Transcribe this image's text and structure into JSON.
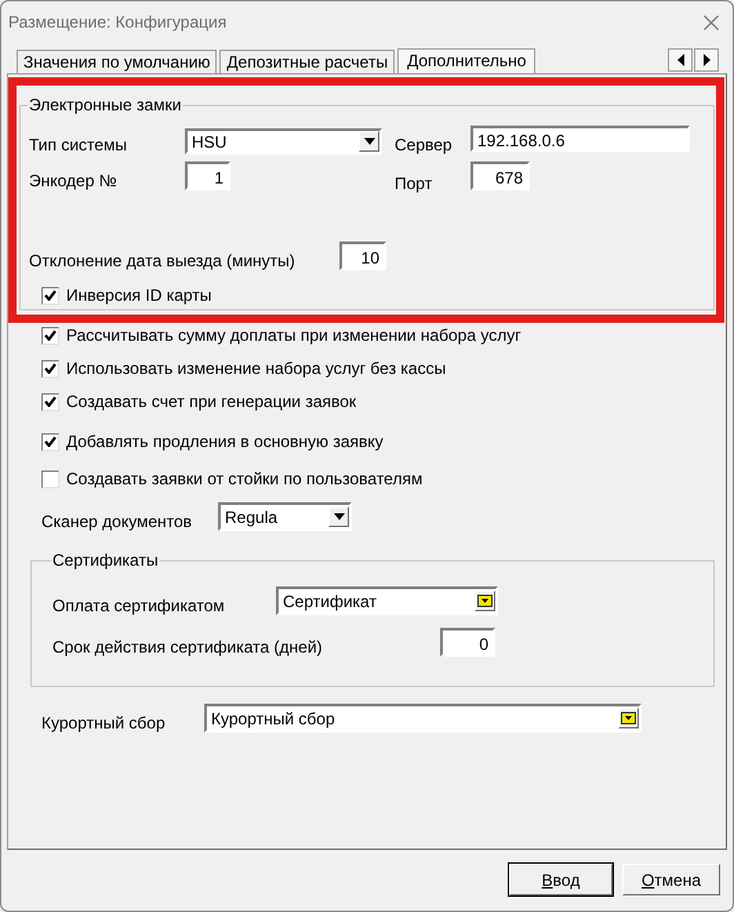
{
  "window": {
    "title": "Размещение: Конфигурация"
  },
  "tabs": [
    {
      "label": "Значения по умолчанию",
      "selected": false
    },
    {
      "label": "Депозитные расчеты",
      "selected": false
    },
    {
      "label": "Дополнительно",
      "selected": true
    }
  ],
  "electronic_locks": {
    "title": "Электронные замки",
    "system_type": {
      "label": "Тип системы",
      "value": "HSU"
    },
    "server": {
      "label": "Сервер",
      "value": "192.168.0.6"
    },
    "encoder": {
      "label": "Энкодер №",
      "value": "1"
    },
    "port": {
      "label": "Порт",
      "value": "678"
    },
    "checkout_deviation": {
      "label": "Отклонение дата выезда (минуты)",
      "value": "10"
    },
    "card_id_inversion": {
      "label": "Инверсия ID карты",
      "checked": true
    }
  },
  "options": [
    {
      "label": "Рассчитывать сумму доплаты при изменении набора услуг",
      "checked": true
    },
    {
      "label": "Использовать изменение набора услуг без кассы",
      "checked": true
    },
    {
      "label": "Создавать счет при генерации заявок",
      "checked": true
    },
    {
      "label": "Добавлять продления в основную заявку",
      "checked": true
    },
    {
      "label": "Создавать заявки от стойки по пользователям",
      "checked": false
    }
  ],
  "document_scanner": {
    "label": "Сканер документов",
    "value": "Regula"
  },
  "certificates": {
    "title": "Сертификаты",
    "payment": {
      "label": "Оплата сертификатом",
      "value": "Сертификат"
    },
    "validity": {
      "label": "Срок действия сертификата (дней)",
      "value": "0"
    }
  },
  "resort_fee": {
    "label": "Курортный сбор",
    "value": "Курортный сбор"
  },
  "buttons": [
    {
      "label": "Ввод",
      "default": true,
      "underline_first": true
    },
    {
      "label": "Отмена",
      "default": false,
      "underline_first": true
    }
  ]
}
